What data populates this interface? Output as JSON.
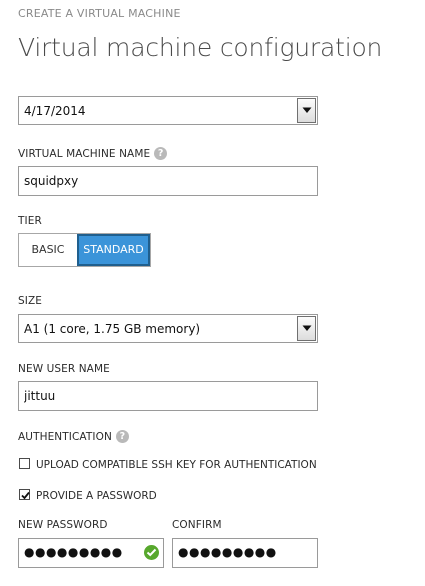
{
  "header": {
    "breadcrumb": "CREATE A VIRTUAL MACHINE",
    "title": "Virtual machine configuration"
  },
  "version_select": {
    "value": "4/17/2014"
  },
  "vm_name": {
    "label": "VIRTUAL MACHINE NAME",
    "value": "squidpxy",
    "help_icon": "help-icon"
  },
  "tier": {
    "label": "TIER",
    "options": [
      "BASIC",
      "STANDARD"
    ],
    "selected": "STANDARD"
  },
  "size": {
    "label": "SIZE",
    "value": "A1 (1 core, 1.75 GB memory)"
  },
  "user_name": {
    "label": "NEW USER NAME",
    "value": "jittuu"
  },
  "authentication": {
    "label": "AUTHENTICATION",
    "help_icon": "help-icon",
    "ssh_key": {
      "label": "UPLOAD COMPATIBLE SSH KEY FOR AUTHENTICATION",
      "checked": false
    },
    "password": {
      "label": "PROVIDE A PASSWORD",
      "checked": true
    }
  },
  "new_password": {
    "label": "NEW PASSWORD",
    "value": "●●●●●●●●●",
    "status_icon": "check-circle-icon"
  },
  "confirm": {
    "label": "CONFIRM",
    "value": "●●●●●●●●●"
  },
  "colors": {
    "accent": "#3b94d9",
    "accent_border": "#1f5f8e",
    "valid": "#57a82d",
    "label": "#2b2b2b",
    "muted": "#8a8a8a"
  }
}
